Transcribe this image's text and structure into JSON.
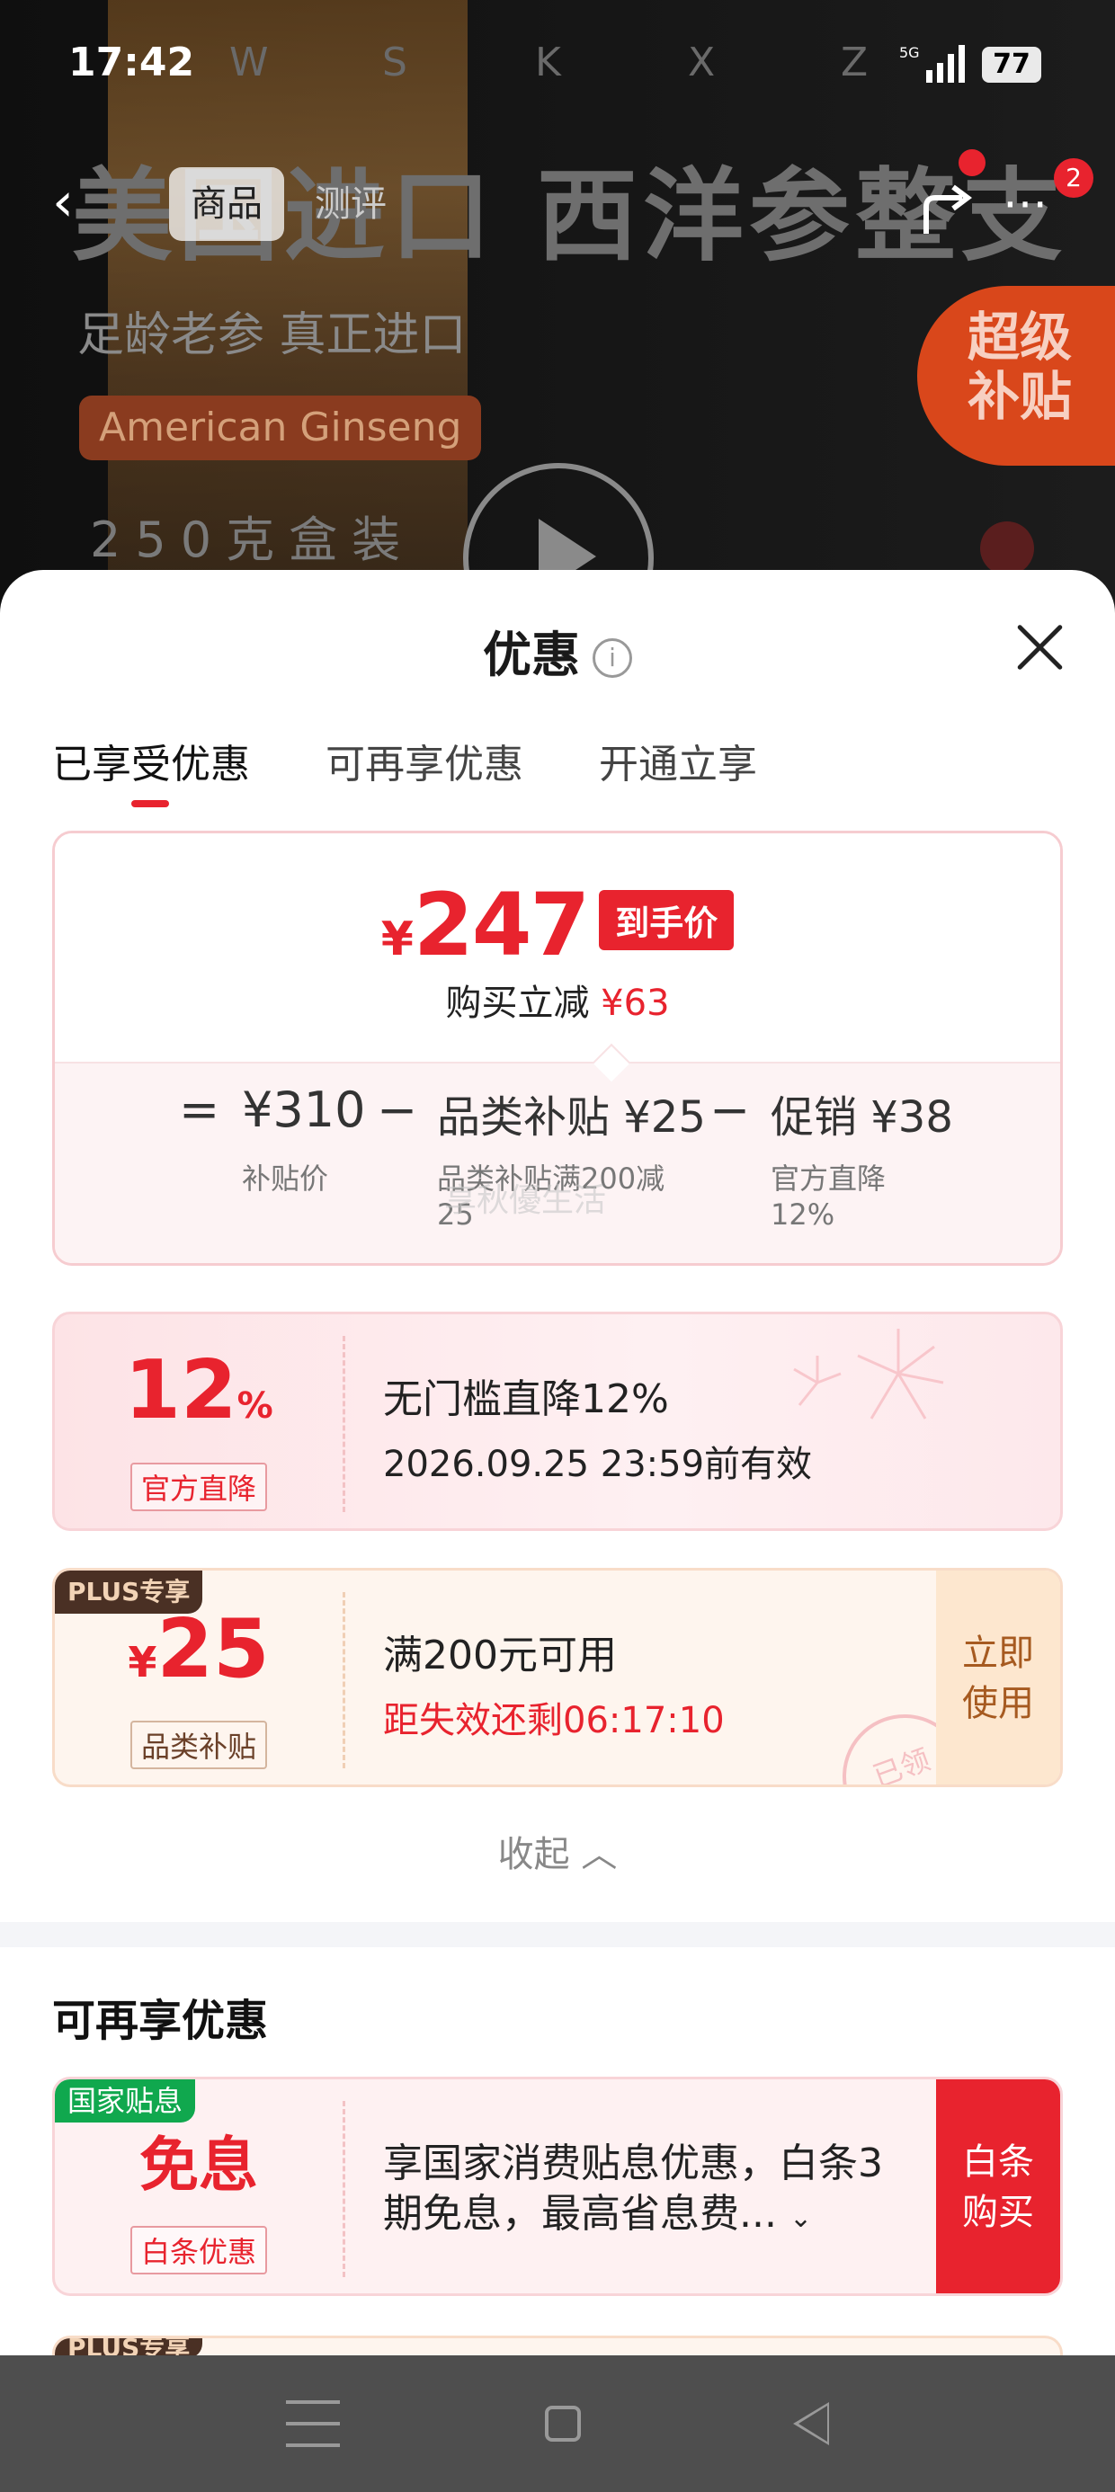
{
  "status_bar": {
    "time": "17:42",
    "letters": [
      "W",
      "S",
      "K",
      "X",
      "Z"
    ],
    "network": "5G",
    "battery": "77"
  },
  "header": {
    "tabs": [
      "商品",
      "测评"
    ],
    "badge_count": "2"
  },
  "video": {
    "title": "美国进口 西洋参整支",
    "subtitle": "足龄老参 真正进口",
    "english_tag": "American Ginseng",
    "package": "250克盒装",
    "subsidy_badge": [
      "超级",
      "补贴"
    ]
  },
  "sheet": {
    "title": "优惠",
    "tabs": [
      "已享受优惠",
      "可再享优惠",
      "开通立享"
    ],
    "price_card": {
      "currency": "¥",
      "final_price": "247",
      "price_tag": "到手价",
      "save_label": "购买立减",
      "save_amount": "¥63",
      "breakdown": [
        {
          "op": "=",
          "value": "¥310",
          "label": "补贴价"
        },
        {
          "op": "−",
          "value": "品类补贴 ¥25",
          "label": "品类补贴满200减25"
        },
        {
          "op": "−",
          "value": "促销 ¥38",
          "label": "官方直降12%"
        }
      ],
      "watermark": "享秋優生活"
    },
    "coupons": [
      {
        "big": "12",
        "unit": "%",
        "label": "官方直降",
        "line1": "无门槛直降12%",
        "line2": "2026.09.25 23:59前有效"
      },
      {
        "badge": "PLUS专享",
        "currency": "¥",
        "big": "25",
        "label": "品类补贴",
        "line1": "满200元可用",
        "line2": "距失效还剩06:17:10",
        "button": [
          "立即",
          "使用"
        ],
        "stamp": "已领"
      }
    ],
    "collapse_label": "收起",
    "more_section": {
      "title": "可再享优惠",
      "card": {
        "badge": "国家贴息",
        "big": "免息",
        "label": "白条优惠",
        "desc": "享国家消费贴息优惠，白条3期免息，最高省息费...",
        "button": [
          "白条",
          "购买"
        ]
      },
      "peek_badge": "PLUS专享"
    }
  }
}
